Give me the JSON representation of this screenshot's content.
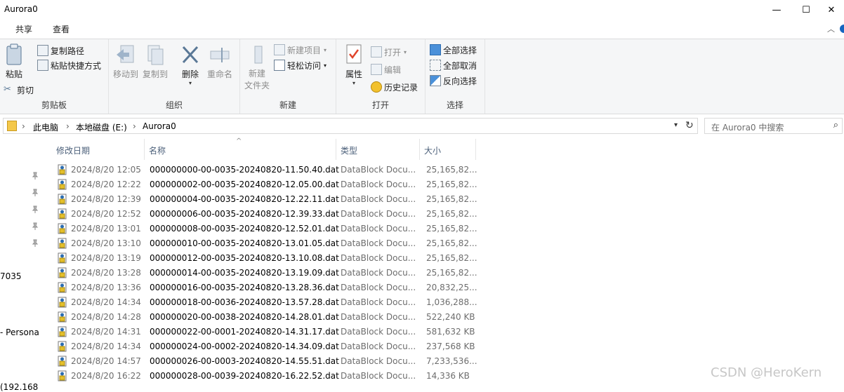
{
  "window": {
    "title": "Aurora0",
    "minimize": "—",
    "maximize": "☐",
    "close": "✕"
  },
  "ribbon_tabs": [
    "共享",
    "查看"
  ],
  "ribbon": {
    "clipboard": {
      "paste": "粘贴",
      "copy_path": "复制路径",
      "paste_shortcut": "粘贴快捷方式",
      "cut": "剪切",
      "label": "剪贴板"
    },
    "organize": {
      "move_to": "移动到",
      "copy_to": "复制到",
      "delete": "删除",
      "rename": "重命名",
      "label": "组织"
    },
    "new": {
      "new_folder": "新建\n文件夹",
      "new_item": "新建项目",
      "easy_access": "轻松访问",
      "label": "新建"
    },
    "open": {
      "properties": "属性",
      "open": "打开",
      "edit": "编辑",
      "history": "历史记录",
      "label": "打开"
    },
    "select": {
      "select_all": "全部选择",
      "select_none": "全部取消",
      "invert": "反向选择",
      "label": "选择"
    }
  },
  "address": {
    "crumbs": [
      "此电脑",
      "本地磁盘 (E:)",
      "Aurora0"
    ]
  },
  "search": {
    "placeholder": "在 Aurora0 中搜索"
  },
  "columns": [
    "修改日期",
    "名称",
    "类型",
    "大小"
  ],
  "files": [
    {
      "date": "2024/8/20 12:05",
      "name": "000000000-00-0035-20240820-11.50.40.dat",
      "type": "DataBlock Docu...",
      "size": "25,165,82..."
    },
    {
      "date": "2024/8/20 12:22",
      "name": "000000002-00-0035-20240820-12.05.00.dat",
      "type": "DataBlock Docu...",
      "size": "25,165,82..."
    },
    {
      "date": "2024/8/20 12:39",
      "name": "000000004-00-0035-20240820-12.22.11.dat",
      "type": "DataBlock Docu...",
      "size": "25,165,82..."
    },
    {
      "date": "2024/8/20 12:52",
      "name": "000000006-00-0035-20240820-12.39.33.dat",
      "type": "DataBlock Docu...",
      "size": "25,165,82..."
    },
    {
      "date": "2024/8/20 13:01",
      "name": "000000008-00-0035-20240820-12.52.01.dat",
      "type": "DataBlock Docu...",
      "size": "25,165,82..."
    },
    {
      "date": "2024/8/20 13:10",
      "name": "000000010-00-0035-20240820-13.01.05.dat",
      "type": "DataBlock Docu...",
      "size": "25,165,82..."
    },
    {
      "date": "2024/8/20 13:19",
      "name": "000000012-00-0035-20240820-13.10.08.dat",
      "type": "DataBlock Docu...",
      "size": "25,165,82..."
    },
    {
      "date": "2024/8/20 13:28",
      "name": "000000014-00-0035-20240820-13.19.09.dat",
      "type": "DataBlock Docu...",
      "size": "25,165,82..."
    },
    {
      "date": "2024/8/20 13:36",
      "name": "000000016-00-0035-20240820-13.28.36.dat",
      "type": "DataBlock Docu...",
      "size": "20,832,25..."
    },
    {
      "date": "2024/8/20 14:34",
      "name": "000000018-00-0036-20240820-13.57.28.dat",
      "type": "DataBlock Docu...",
      "size": "1,036,288..."
    },
    {
      "date": "2024/8/20 14:28",
      "name": "000000020-00-0038-20240820-14.28.01.dat",
      "type": "DataBlock Docu...",
      "size": "522,240 KB"
    },
    {
      "date": "2024/8/20 14:31",
      "name": "000000022-00-0001-20240820-14.31.17.dat",
      "type": "DataBlock Docu...",
      "size": "581,632 KB"
    },
    {
      "date": "2024/8/20 14:34",
      "name": "000000024-00-0002-20240820-14.34.09.dat",
      "type": "DataBlock Docu...",
      "size": "237,568 KB"
    },
    {
      "date": "2024/8/20 14:57",
      "name": "000000026-00-0003-20240820-14.55.51.dat",
      "type": "DataBlock Docu...",
      "size": "7,233,536..."
    },
    {
      "date": "2024/8/20 16:22",
      "name": "000000028-00-0039-20240820-16.22.52.dat",
      "type": "DataBlock Docu...",
      "size": "14,336 KB"
    }
  ],
  "nav_pane": {
    "item_a": "7035",
    "item_b": "- Persona",
    "item_c": "(192.168"
  },
  "watermark": "CSDN @HeroKern"
}
